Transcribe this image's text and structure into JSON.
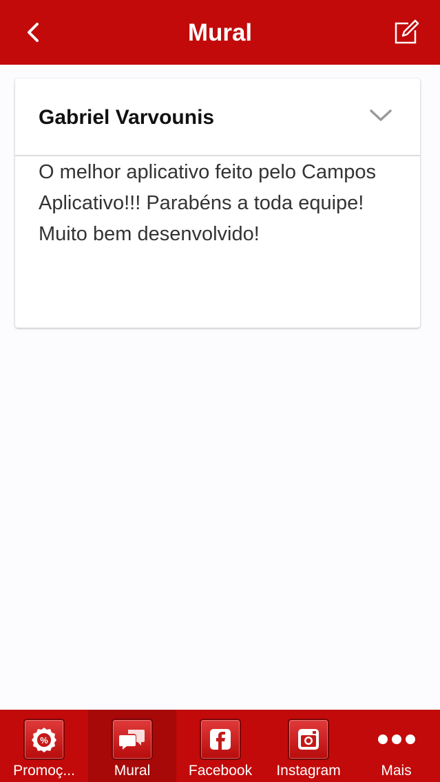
{
  "nav": {
    "title": "Mural"
  },
  "post": {
    "author": "Gabriel Varvounis",
    "message": "O melhor aplicativo feito pelo Campos Aplicativo!!! Parabéns a toda equipe! Muito bem desenvolvido!"
  },
  "tabs": [
    {
      "label": "Promoç...",
      "icon": "percent-badge-icon"
    },
    {
      "label": "Mural",
      "icon": "chat-bubbles-icon",
      "active": true
    },
    {
      "label": "Facebook",
      "icon": "facebook-icon"
    },
    {
      "label": "Instagram",
      "icon": "instagram-icon"
    },
    {
      "label": "Mais",
      "icon": "more-dots-icon"
    }
  ],
  "colors": {
    "brand_red": "#c20a0a",
    "active_tab": "#a70808",
    "background": "#fcfbfd"
  }
}
